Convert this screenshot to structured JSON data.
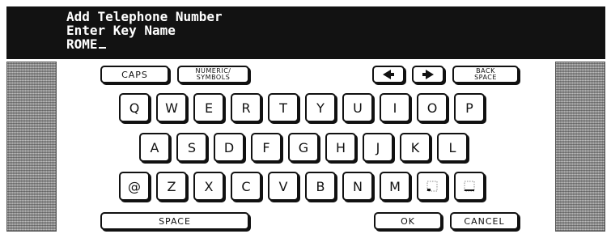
{
  "header": {
    "line1": "Add Telephone Number",
    "line2": "Enter Key Name",
    "input_value": "ROME"
  },
  "top_row": {
    "caps": "CAPS",
    "numeric_line1": "NUMERIC/",
    "numeric_line2": "SYMBOLS",
    "back_line1": "BACK",
    "back_line2": "SPACE",
    "left_icon": "left-arrow-icon",
    "right_icon": "right-arrow-icon"
  },
  "keyboard": {
    "row1": [
      "Q",
      "W",
      "E",
      "R",
      "T",
      "Y",
      "U",
      "I",
      "O",
      "P"
    ],
    "row2": [
      "A",
      "S",
      "D",
      "F",
      "G",
      "H",
      "J",
      "K",
      "L"
    ],
    "row3": [
      "@",
      "Z",
      "X",
      "C",
      "V",
      "B",
      "N",
      "M"
    ],
    "row3_icons": [
      "dotted-square-icon",
      "underscore-box-icon"
    ]
  },
  "bottom_row": {
    "space": "SPACE",
    "ok": "OK",
    "cancel": "CANCEL"
  },
  "colors": {
    "header_bg": "#121212",
    "panel_gray": "#9a9a9a",
    "key_border": "#111111"
  }
}
